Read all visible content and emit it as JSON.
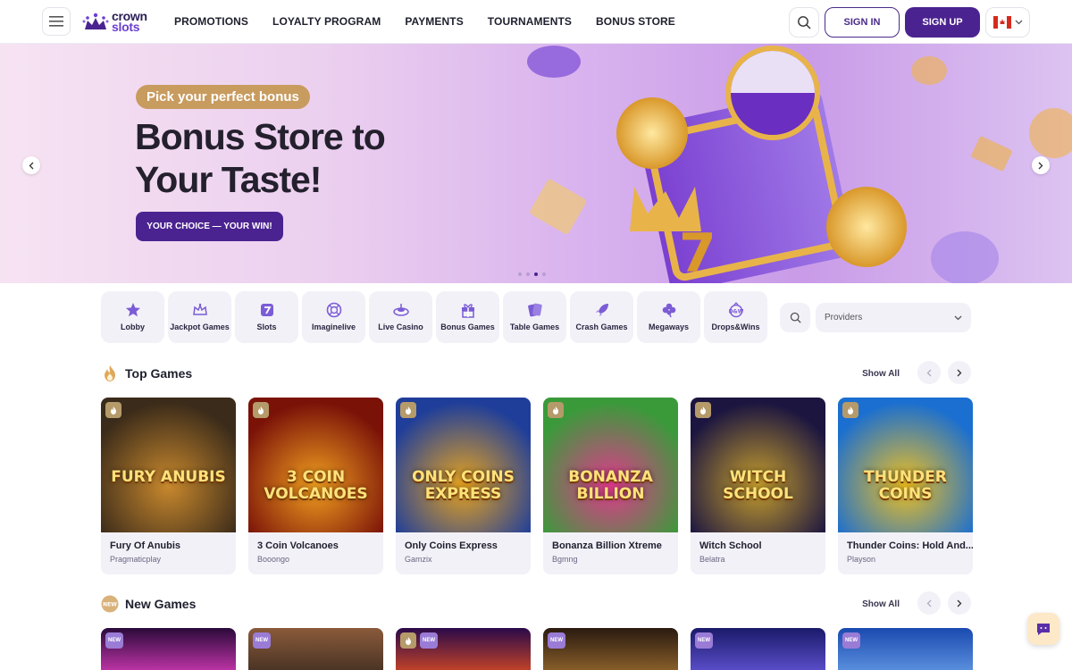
{
  "brand": {
    "line1": "crown",
    "line2": "slots"
  },
  "nav": [
    "PROMOTIONS",
    "LOYALTY PROGRAM",
    "PAYMENTS",
    "TOURNAMENTS",
    "BONUS STORE"
  ],
  "auth": {
    "signin": "SIGN IN",
    "signup": "SIGN UP"
  },
  "hero": {
    "badge": "Pick your perfect bonus",
    "title_line1": "Bonus Store to",
    "title_line2": "Your Taste!",
    "cta": "YOUR CHOICE — YOUR WIN!",
    "active_slide": 3,
    "slide_count": 4
  },
  "categories": [
    {
      "label": "Lobby",
      "icon": "star-icon"
    },
    {
      "label": "Jackpot Games",
      "icon": "crown-icon"
    },
    {
      "label": "Slots",
      "icon": "slot-seven-icon"
    },
    {
      "label": "Imaginelive",
      "icon": "chip-icon"
    },
    {
      "label": "Live Casino",
      "icon": "roulette-icon"
    },
    {
      "label": "Bonus Games",
      "icon": "gift-icon"
    },
    {
      "label": "Table Games",
      "icon": "cards-icon"
    },
    {
      "label": "Crash Games",
      "icon": "rocket-icon"
    },
    {
      "label": "Megaways",
      "icon": "clover-icon"
    },
    {
      "label": "Drops&Wins",
      "icon": "drops-icon"
    }
  ],
  "providers": {
    "placeholder": "Providers"
  },
  "top_games": {
    "title": "Top Games",
    "show_all": "Show All",
    "games": [
      {
        "name": "Fury Of Anubis",
        "provider": "Pragmaticplay",
        "art": "FURY ANUBIS",
        "colors": [
          "#3b2b1a",
          "#c9892d"
        ]
      },
      {
        "name": "3 Coin Volcanoes",
        "provider": "Booongo",
        "art": "3 COIN VOLCANOES",
        "colors": [
          "#7a1208",
          "#f2a020"
        ]
      },
      {
        "name": "Only Coins Express",
        "provider": "Gamzix",
        "art": "ONLY COINS EXPRESS",
        "colors": [
          "#1f3e9a",
          "#e9a41e"
        ]
      },
      {
        "name": "Bonanza Billion Xtreme",
        "provider": "Bgmng",
        "art": "BONANZA BILLION",
        "colors": [
          "#3a9a3a",
          "#e2398e"
        ]
      },
      {
        "name": "Witch School",
        "provider": "Belatra",
        "art": "WITCH SCHOOL",
        "colors": [
          "#1b1540",
          "#c79f2d"
        ]
      },
      {
        "name": "Thunder Coins: Hold And...",
        "provider": "Playson",
        "art": "THUNDER COINS",
        "colors": [
          "#1b6fd0",
          "#f0c020"
        ]
      }
    ]
  },
  "new_games": {
    "title": "New Games",
    "show_all": "Show All",
    "tag": "NEW",
    "thumbs": [
      {
        "colors": [
          "#2a0a3a",
          "#e23ec0"
        ]
      },
      {
        "colors": [
          "#8a5a3a",
          "#3a2a20"
        ]
      },
      {
        "colors": [
          "#2a0a4a",
          "#e85020"
        ]
      },
      {
        "colors": [
          "#2a1a10",
          "#a07030"
        ]
      },
      {
        "colors": [
          "#1a1a6a",
          "#6a5ae0"
        ]
      },
      {
        "colors": [
          "#1a4ab0",
          "#6aa0e8"
        ]
      }
    ]
  }
}
